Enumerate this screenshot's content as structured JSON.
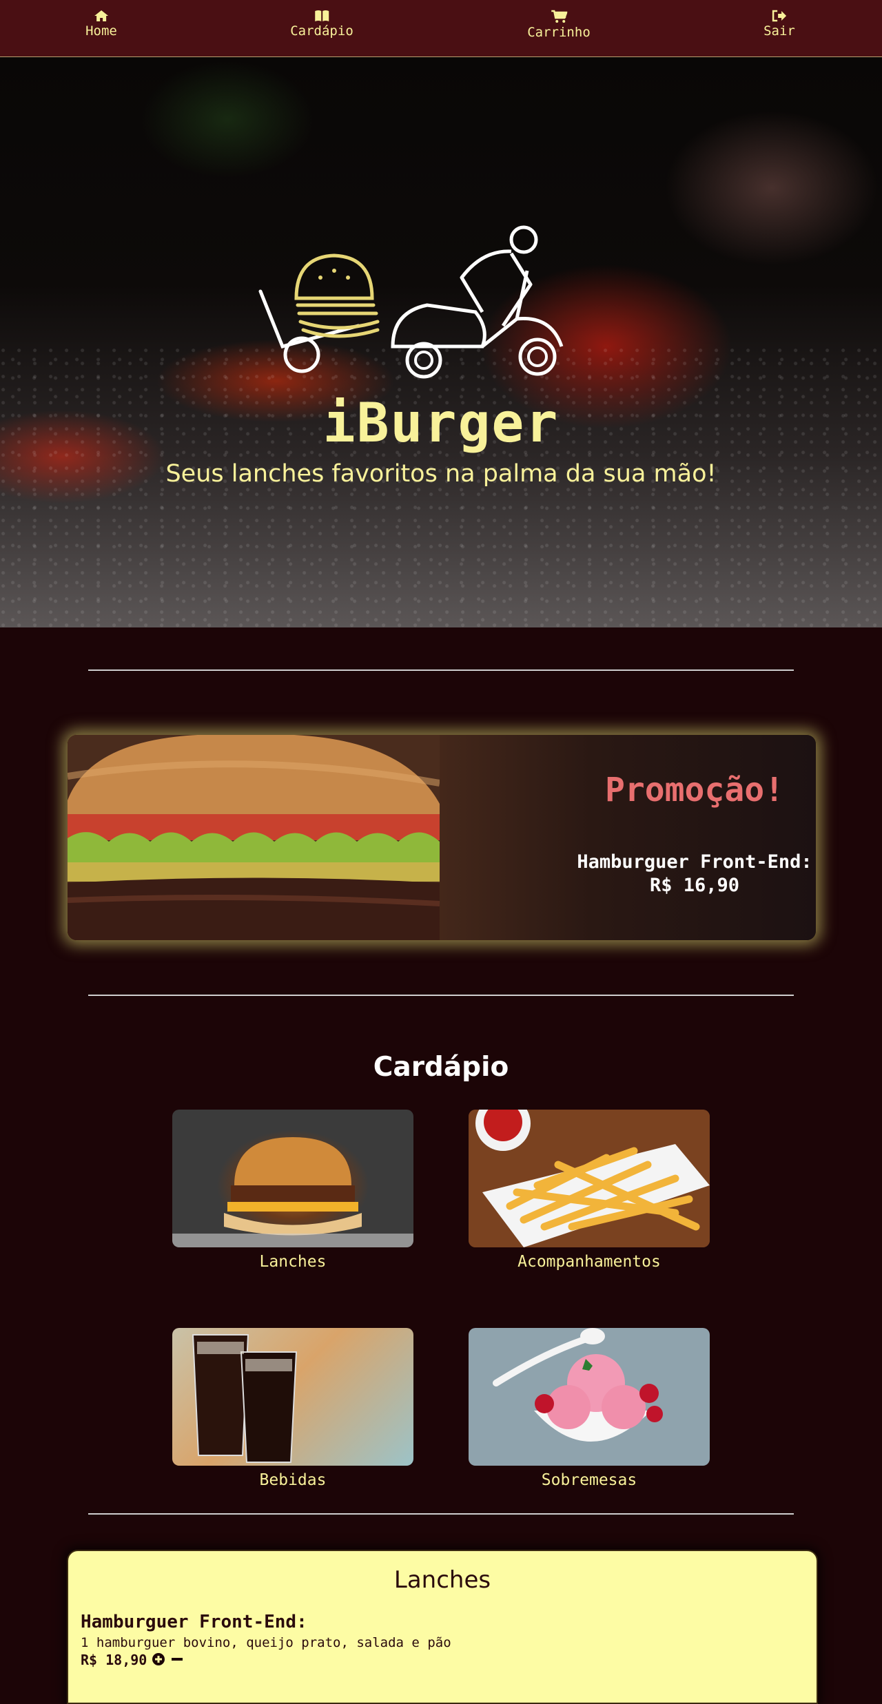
{
  "nav": {
    "home": {
      "label": "Home",
      "icon": "home-icon"
    },
    "menu": {
      "label": "Cardápio",
      "icon": "book-icon"
    },
    "cart": {
      "label": "Carrinho",
      "icon": "cart-icon"
    },
    "exit": {
      "label": "Sair",
      "icon": "sign-out-icon"
    }
  },
  "hero": {
    "brand": "iBurger",
    "tagline": "Seus lanches favoritos na palma da sua mão!"
  },
  "promo": {
    "title": "Promoção!",
    "item_line": "Hamburguer Front-End:",
    "price_line": "R$ 16,90"
  },
  "menu": {
    "title": "Cardápio",
    "categories": [
      {
        "label": "Lanches"
      },
      {
        "label": "Acompanhamentos"
      },
      {
        "label": "Bebidas"
      },
      {
        "label": "Sobremesas"
      }
    ]
  },
  "lanches": {
    "title": "Lanches",
    "items": [
      {
        "name": "Hamburguer Front-End:",
        "description": "1 hamburguer bovino, queijo prato, salada e pão",
        "price": "R$ 18,90"
      }
    ]
  },
  "colors": {
    "nav_bg": "#4a0f13",
    "page_bg": "#1c0507",
    "accent_yellow": "#f8f19a",
    "promo_title": "#e86f6f",
    "card_bg": "#fdfca4"
  }
}
